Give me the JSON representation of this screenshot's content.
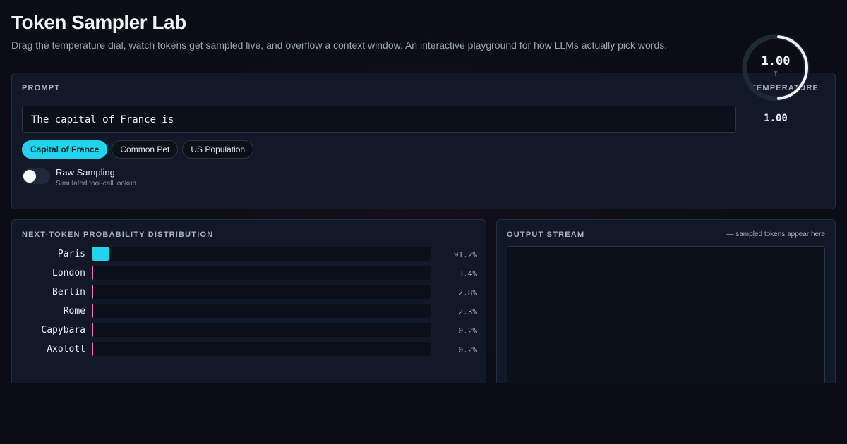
{
  "header": {
    "title": "Token Sampler Lab",
    "subtitle": "Drag the temperature dial, watch tokens get sampled live, and overflow a context window. An interactive playground for how LLMs actually pick words."
  },
  "prompt": {
    "label": "PROMPT",
    "input_value": "The capital of France is",
    "presets": [
      "Capital of France",
      "Common Pet",
      "US Population"
    ],
    "active_preset": "Capital of France",
    "toggle": {
      "title": "Raw Sampling",
      "subtitle": "Simulated tool-call lookup",
      "on": false
    }
  },
  "temperature": {
    "label": "TEMPERATURE",
    "dial_value": "1.00",
    "dial_symbol": "T",
    "readout": "1.00",
    "level_fraction": 0.5
  },
  "distribution": {
    "label": "NEXT-TOKEN PROBABILITY DISTRIBUTION",
    "tokens": [
      {
        "token": "Paris",
        "pct": "91.2%",
        "value": 91.2,
        "color": "#22d3ee"
      },
      {
        "token": "London",
        "pct": "3.4%",
        "value": 3.4,
        "color": "#f472b6"
      },
      {
        "token": "Berlin",
        "pct": "2.8%",
        "value": 2.8,
        "color": "#f472b6"
      },
      {
        "token": "Rome",
        "pct": "2.3%",
        "value": 2.3,
        "color": "#f472b6"
      },
      {
        "token": "Capybara",
        "pct": "0.2%",
        "value": 0.2,
        "color": "#f472b6"
      },
      {
        "token": "Axolotl",
        "pct": "0.2%",
        "value": 0.2,
        "color": "#f472b6"
      }
    ]
  },
  "output": {
    "label": "OUTPUT STREAM",
    "hint": "— sampled tokens appear here"
  },
  "colors": {
    "accent": "#22d3ee",
    "panel": "#111827",
    "background": "#0a0d14",
    "tail": "#f472b6"
  }
}
